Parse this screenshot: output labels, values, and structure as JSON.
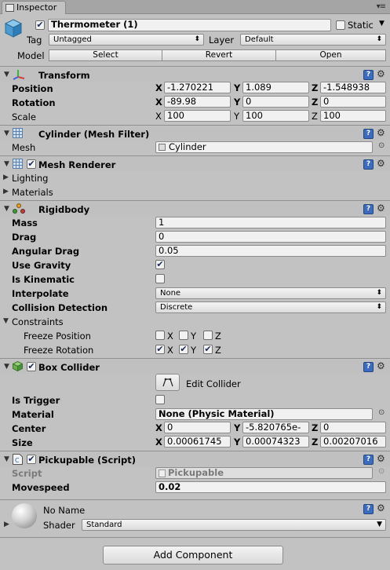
{
  "tab": {
    "title": "Inspector"
  },
  "header": {
    "name": "Thermometer (1)",
    "static_label": "Static",
    "tag_label": "Tag",
    "tag_value": "Untagged",
    "layer_label": "Layer",
    "layer_value": "Default",
    "model_label": "Model",
    "model_buttons": [
      "Select",
      "Revert",
      "Open"
    ]
  },
  "transform": {
    "title": "Transform",
    "rows": [
      {
        "label": "Position",
        "x": "-1.270221",
        "y": "1.089",
        "z": "-1.548938"
      },
      {
        "label": "Rotation",
        "x": "-89.98",
        "y": "0",
        "z": "0"
      },
      {
        "label": "Scale",
        "x": "100",
        "y": "100",
        "z": "100"
      }
    ]
  },
  "mesh_filter": {
    "title": "Cylinder (Mesh Filter)",
    "mesh_label": "Mesh",
    "mesh_value": "Cylinder"
  },
  "mesh_renderer": {
    "title": "Mesh Renderer",
    "lighting": "Lighting",
    "materials": "Materials"
  },
  "rigidbody": {
    "title": "Rigidbody",
    "mass_label": "Mass",
    "mass": "1",
    "drag_label": "Drag",
    "drag": "0",
    "angular_drag_label": "Angular Drag",
    "angular_drag": "0.05",
    "use_gravity_label": "Use Gravity",
    "is_kinematic_label": "Is Kinematic",
    "interpolate_label": "Interpolate",
    "interpolate": "None",
    "collision_label": "Collision Detection",
    "collision": "Discrete",
    "constraints_label": "Constraints",
    "freeze_position_label": "Freeze Position",
    "freeze_rotation_label": "Freeze Rotation",
    "x": "X",
    "y": "Y",
    "z": "Z"
  },
  "box_collider": {
    "title": "Box Collider",
    "edit_collider": "Edit Collider",
    "is_trigger_label": "Is Trigger",
    "material_label": "Material",
    "material_value": "None (Physic Material)",
    "center_label": "Center",
    "center": {
      "x": "0",
      "y": "-5.820765e-",
      "z": "0"
    },
    "size_label": "Size",
    "size": {
      "x": "0.00061745",
      "y": "0.00074323",
      "z": "0.00207016"
    }
  },
  "pickupable": {
    "title": "Pickupable (Script)",
    "script_label": "Script",
    "script_value": "Pickupable",
    "movespeed_label": "Movespeed",
    "movespeed": "0.02"
  },
  "material": {
    "name": "No Name",
    "shader_label": "Shader",
    "shader_value": "Standard"
  },
  "add_component": "Add Component",
  "axes": {
    "x": "X",
    "y": "Y",
    "z": "Z"
  },
  "colors": {
    "panel": "#c2c2c2",
    "check": "#1b2a5a",
    "help_icon": "#3b6cc0"
  }
}
